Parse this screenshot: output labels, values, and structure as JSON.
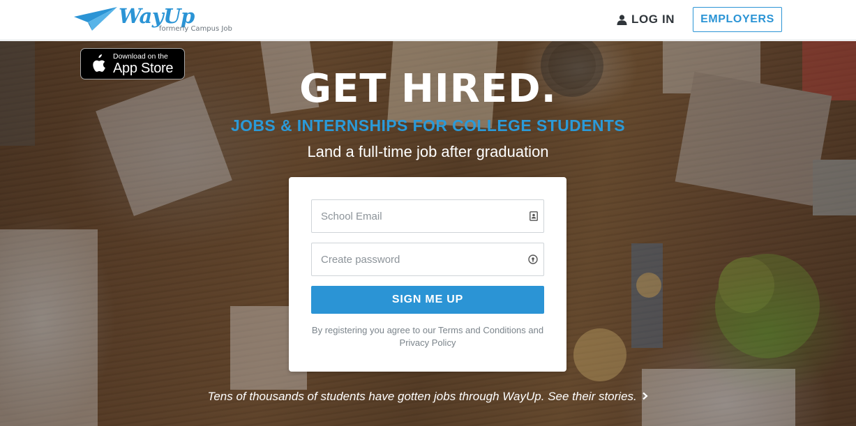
{
  "header": {
    "brand": "WayUp",
    "brand_subtitle": "formerly Campus Job",
    "login_label": "LOG IN",
    "employers_label": "EMPLOYERS"
  },
  "appstore": {
    "small_text": "Download on the",
    "big_text": "App Store"
  },
  "hero": {
    "headline": "GET HIRED.",
    "tagline": "JOBS & INTERNSHIPS FOR COLLEGE STUDENTS",
    "subtagline": "Land a full-time job after graduation"
  },
  "form": {
    "email_placeholder": "School Email",
    "email_value": "",
    "password_placeholder": "Create password",
    "password_value": "",
    "submit_label": "SIGN ME UP",
    "legal_text": "By registering you agree to our Terms and Conditions and Privacy Policy"
  },
  "footer": {
    "stories_text": "Tens of thousands of students have gotten jobs through WayUp.",
    "stories_link": "See their stories.",
    "chevron_icon": "chevron-right-icon"
  },
  "colors": {
    "accent": "#2b94d5",
    "tagline": "#2b9ad8",
    "text_dark": "#2f353a"
  }
}
